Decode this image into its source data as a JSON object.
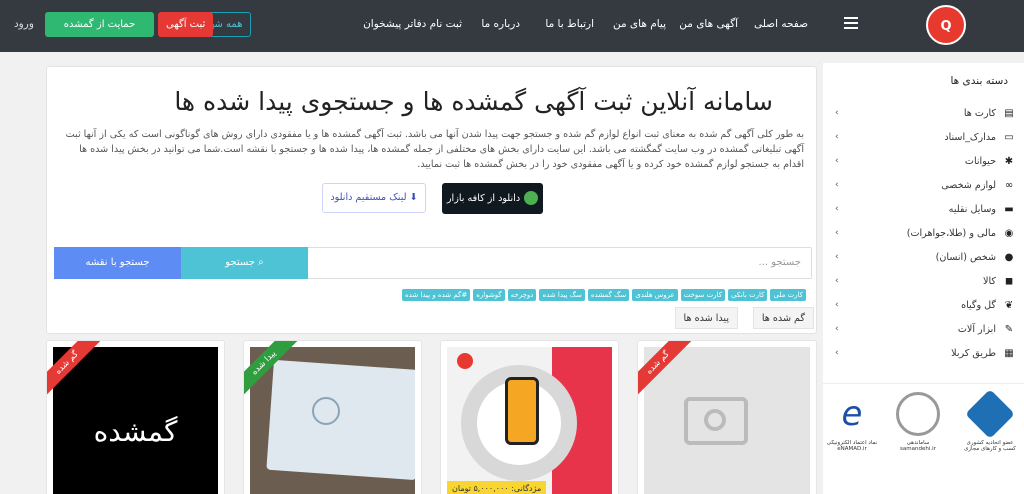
{
  "nav": {
    "links": [
      "صفحه اصلی",
      "آگهی های من",
      "پیام های من",
      "ارتباط با ما",
      "درباره ما",
      "ثبت نام دفاتر پیشخوان"
    ],
    "all_cities": "همه شهرها",
    "post_ad": "ثبت آگهی",
    "support": "حمایت از گمشده",
    "login": "ورود"
  },
  "hero": {
    "title": "سامانه آنلاین ثبت آگهی گمشده ها و جستجوی پیدا شده ها",
    "text": "به طور کلی آگهی گم شده به معنای ثبت انواع لوازم گم شده و جستجو جهت پیدا شدن آنها می باشد. ثبت آگهی گمشده ها و یا مفقودی دارای روش های گوناگونی است که یکی از آنها ثبت آگهی تبلیغاتی گمشده در وب سایت گمگشته می باشد. این سایت دارای بخش های مختلفی از جمله گمشده ها، پیدا شده ها و جستجو با نقشه است.شما می توانید در بخش پیدا شده ها اقدام به جستجو لوازم گمشده خود کرده و یا آگهی مفقودی خود را در بخش گمشده ها ثبت نمایید.",
    "download_bazaar": "دانلود از کافه بازار",
    "download_direct": "لینک مستقیم دانلود"
  },
  "search": {
    "placeholder": "جستجو ...",
    "search_button": "جستجو",
    "map_button": "جستجو با نقشه"
  },
  "tags": [
    "کارت ملی",
    "کارت بانکی",
    "کارت سوخت",
    "عروس هلندی",
    "سگ گمشده",
    "سگ پیدا شده",
    "دوچرخه",
    "گوشواره",
    "#گم شده و پیدا شده"
  ],
  "tabs": [
    "گم شده ها",
    "پیدا شده ها"
  ],
  "cards": [
    {
      "ribbon": "گم شده",
      "image_text": "گمشده"
    },
    {
      "ribbon": "پیدا شده"
    },
    {
      "reward": "مژدگانی: ۵,۰۰۰,۰۰۰ تومان"
    },
    {
      "ribbon": "گم شده"
    }
  ],
  "sidebar": {
    "title": "دسته بندی ها",
    "items": [
      {
        "label": "کارت ها",
        "icon": "id-card-icon"
      },
      {
        "label": "مدارک_اسناد",
        "icon": "document-icon"
      },
      {
        "label": "حیوانات",
        "icon": "paw-icon"
      },
      {
        "label": "لوازم شخصی",
        "icon": "glasses-icon"
      },
      {
        "label": "وسایل نقلیه",
        "icon": "car-icon"
      },
      {
        "label": "مالی و (طلا،جواهرات)",
        "icon": "coins-icon"
      },
      {
        "label": "شخص (انسان)",
        "icon": "person-icon"
      },
      {
        "label": "کالا",
        "icon": "box-icon"
      },
      {
        "label": "گل وگیاه",
        "icon": "leaf-icon"
      },
      {
        "label": "ابزار آلات",
        "icon": "wrench-icon"
      },
      {
        "label": "طریق کربلا",
        "icon": "map-icon"
      }
    ]
  },
  "trust": [
    {
      "caption": "نماد اعتماد الکترونیکی",
      "url": "eNAMAD.ir"
    },
    {
      "caption": "ساماندهی",
      "url": "samandehi.ir"
    },
    {
      "caption": "عضو اتحادیه کشوری کسب و کارهای مجازی"
    }
  ]
}
